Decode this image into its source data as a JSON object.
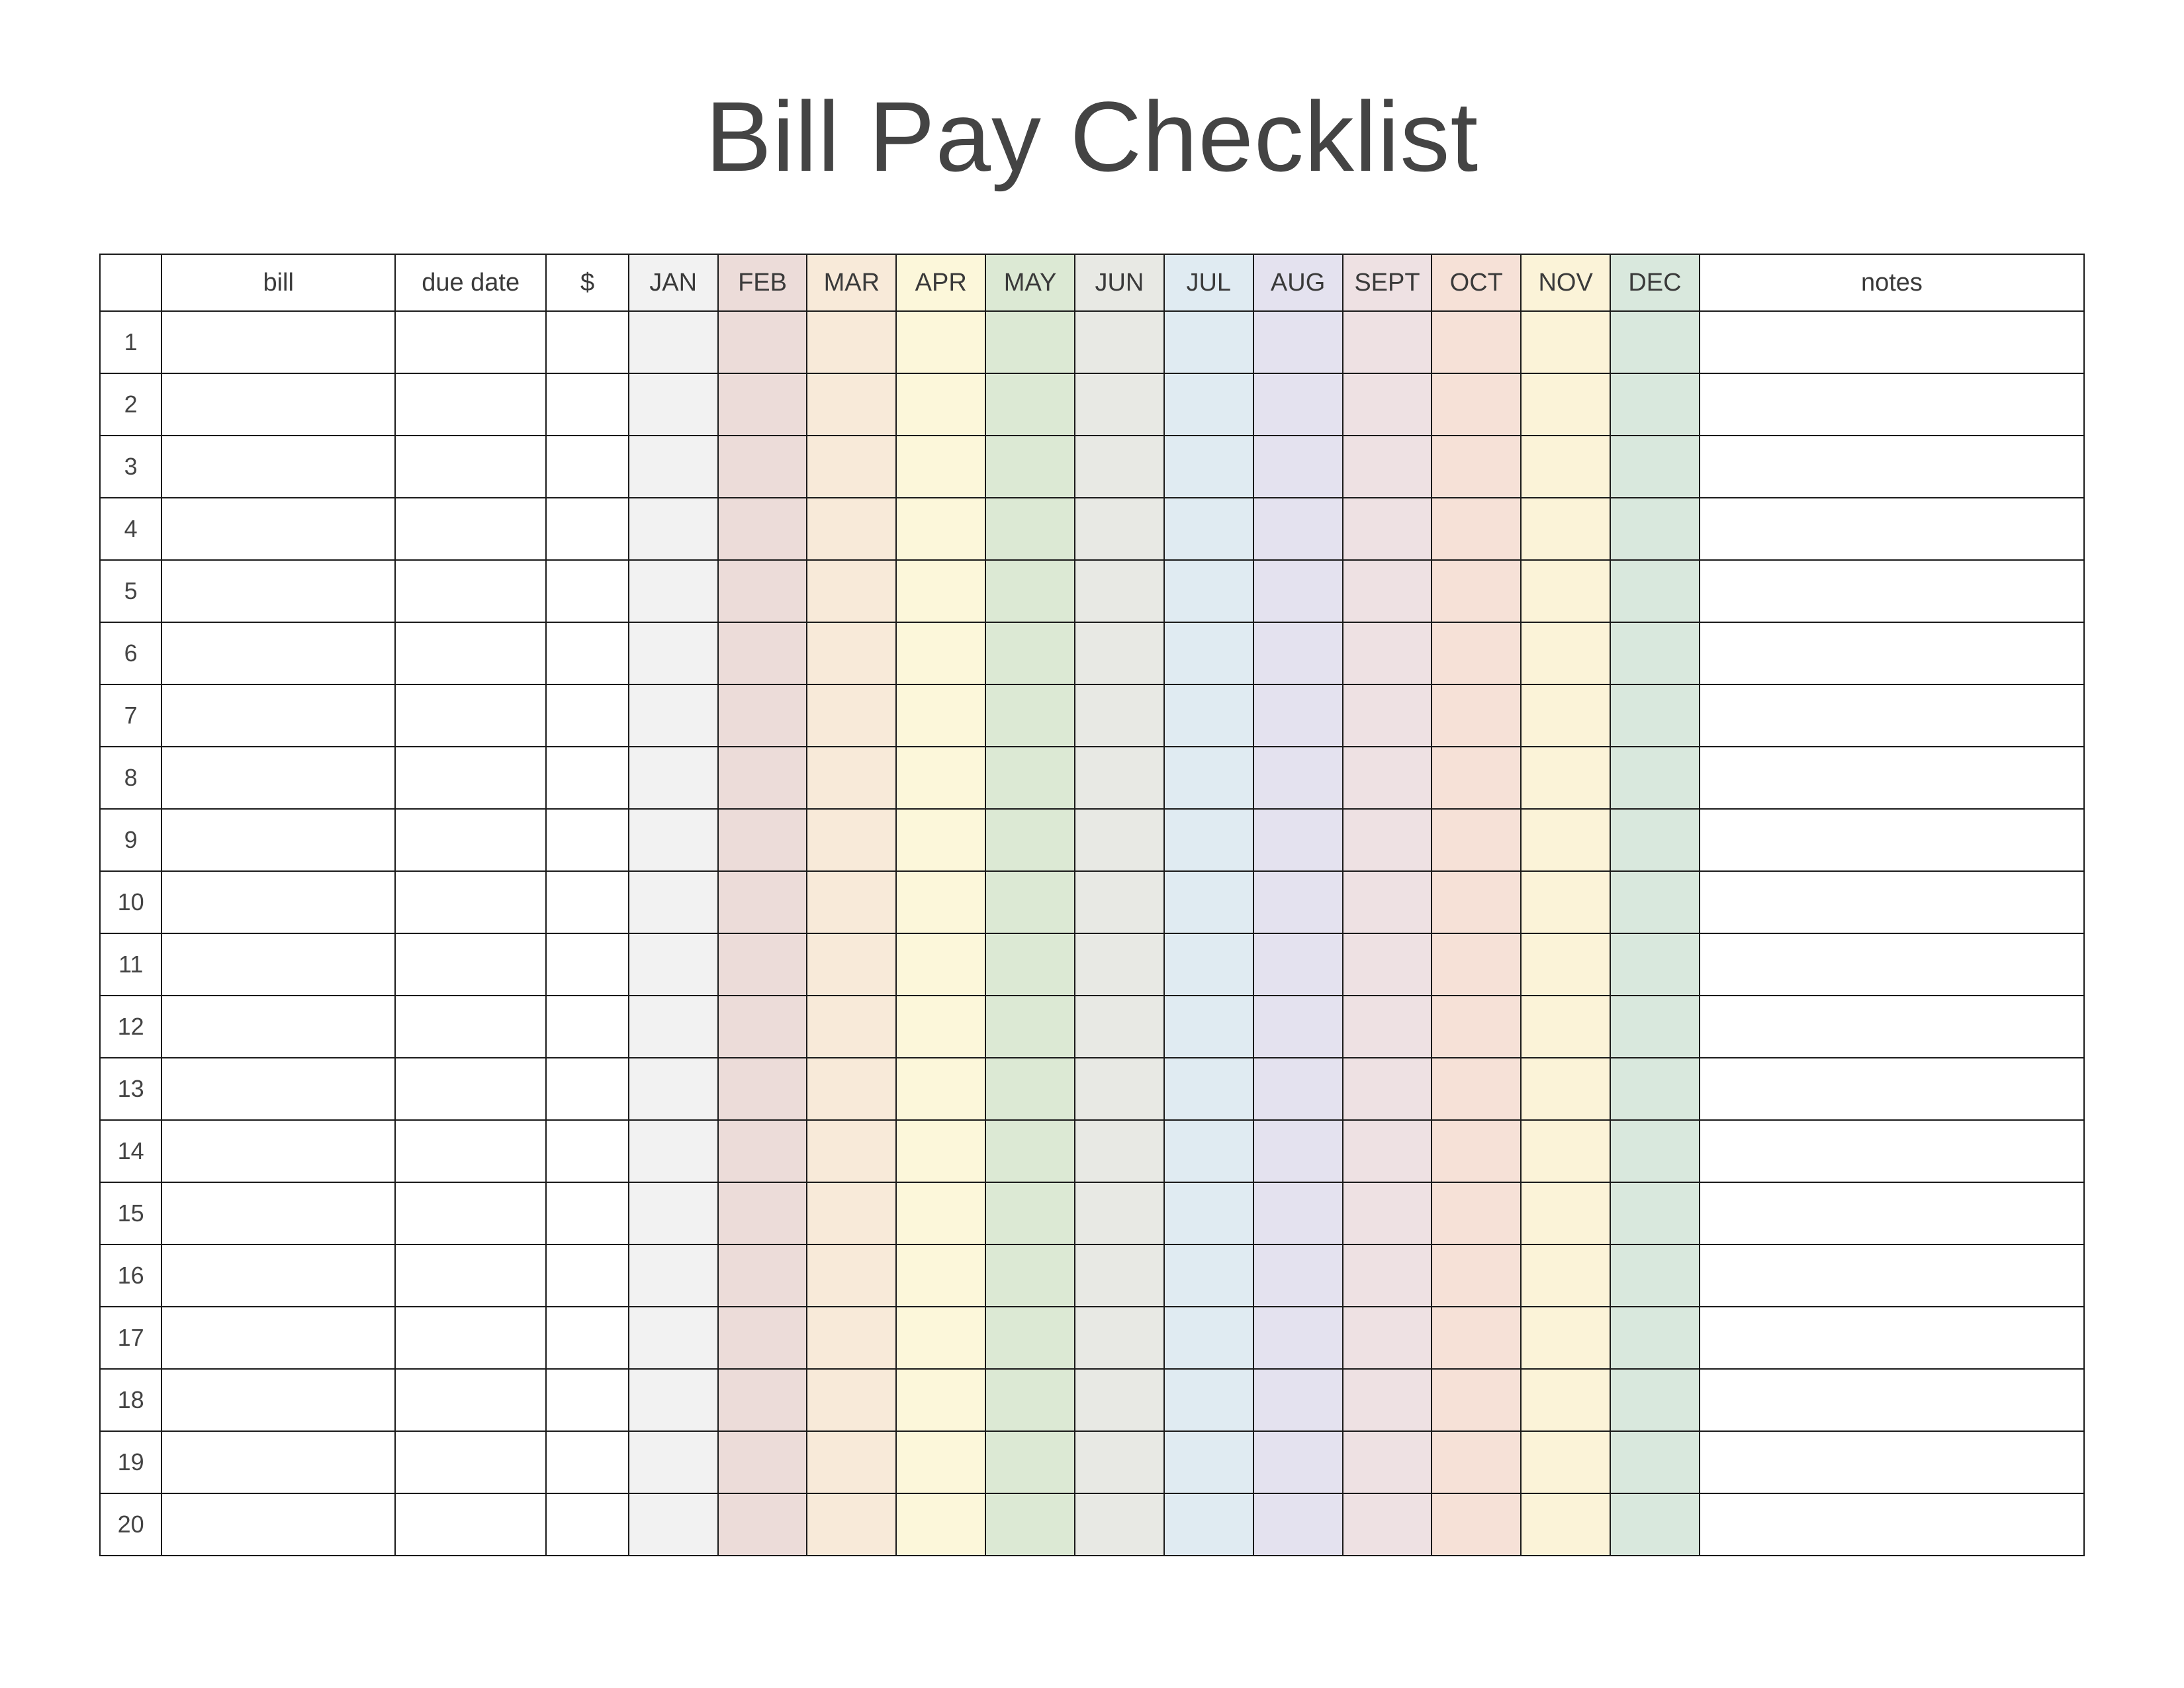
{
  "title": "Bill Pay Checklist",
  "headers": {
    "num": "",
    "bill": "bill",
    "due_date": "due date",
    "amount": "$",
    "notes": "notes"
  },
  "months": [
    "JAN",
    "FEB",
    "MAR",
    "APR",
    "MAY",
    "JUN",
    "JUL",
    "AUG",
    "SEPT",
    "OCT",
    "NOV",
    "DEC"
  ],
  "rows": [
    "1",
    "2",
    "3",
    "4",
    "5",
    "6",
    "7",
    "8",
    "9",
    "10",
    "11",
    "12",
    "13",
    "14",
    "15",
    "16",
    "17",
    "18",
    "19",
    "20"
  ],
  "month_colors": [
    "#f2f2f2",
    "#ecdcd9",
    "#f8ead9",
    "#fcf7da",
    "#dce9d4",
    "#e8e9e4",
    "#e0ebf2",
    "#e4e2ef",
    "#eee1e3",
    "#f6e1d7",
    "#fbf3d8",
    "#d9e8dd"
  ]
}
